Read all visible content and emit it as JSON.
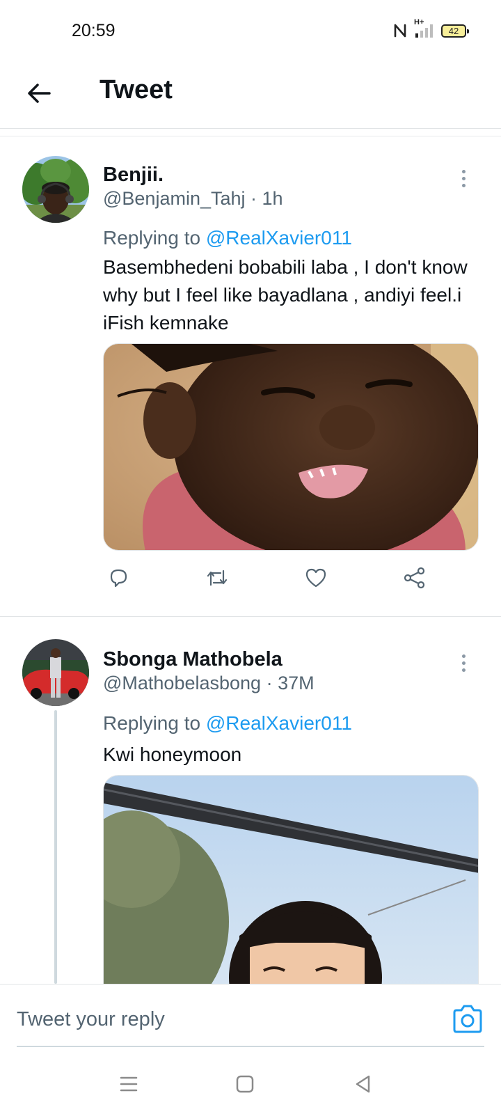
{
  "status_bar": {
    "time": "20:59",
    "network": "H+",
    "battery": "42"
  },
  "header": {
    "title": "Tweet"
  },
  "tweets": [
    {
      "name": "Benjii.",
      "handle": "@Benjamin_Tahj",
      "time": "1h",
      "replying_prefix": "Replying to ",
      "replying_to": "@RealXavier011",
      "text": "Basembhedeni bobabili laba , I don't know why but I feel like bayadlana , andiyi feel.i iFish kemnake"
    },
    {
      "name": "Sbonga Mathobela",
      "handle": "@Mathobelasbong",
      "time": "37M",
      "replying_prefix": "Replying to ",
      "replying_to": "@RealXavier011",
      "text": "Kwi honeymoon"
    }
  ],
  "separator": " · ",
  "reply_bar": {
    "placeholder": "Tweet your reply"
  },
  "colors": {
    "accent": "#1d9bf0",
    "text": "#0f1419",
    "muted": "#536471",
    "border": "#e1e4e6"
  },
  "icons": {
    "header": [
      "back-arrow-icon"
    ],
    "actions": [
      "reply-icon",
      "retweet-icon",
      "like-icon",
      "share-icon"
    ],
    "reply_bar": [
      "camera-icon"
    ],
    "nav": [
      "menu-icon",
      "home-icon",
      "back-icon"
    ]
  }
}
